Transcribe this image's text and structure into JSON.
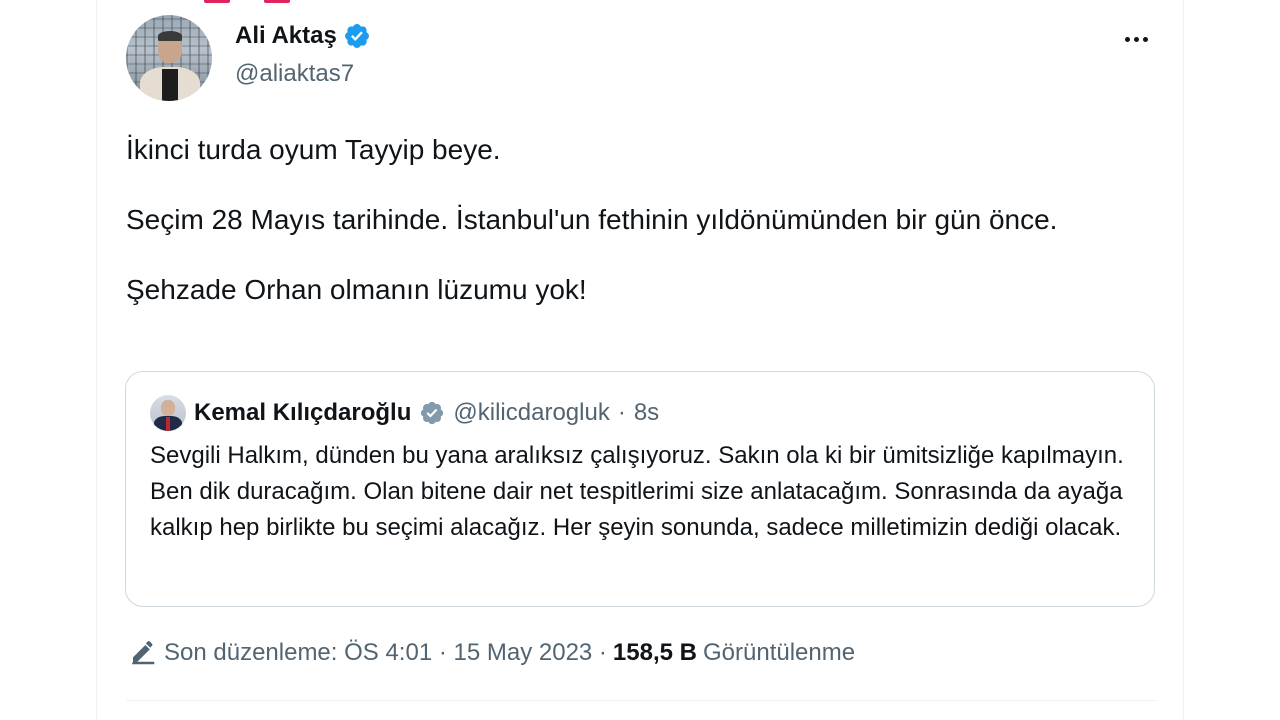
{
  "author": {
    "display_name": "Ali Aktaş",
    "handle": "@aliaktas7"
  },
  "tweet": {
    "paragraphs": [
      "İkinci turda oyum Tayyip beye.",
      "Seçim 28 Mayıs tarihinde. İstanbul'un fethinin yıldönümünden bir gün önce.",
      "Şehzade Orhan olmanın lüzumu yok!"
    ]
  },
  "quoted_tweet": {
    "display_name": "Kemal Kılıçdaroğlu",
    "handle": "@kilicdarogluk",
    "separator": "·",
    "time": "8s",
    "text": "Sevgili Halkım, dünden bu yana aralıksız çalışıyoruz. Sakın ola ki bir ümitsizliğe kapılmayın. Ben dik duracağım. Olan bitene dair net tespitlerimi size anlatacağım. Sonrasında da ayağa kalkıp hep birlikte bu seçimi alacağız. Her şeyin sonunda, sadece milletimizin dediği olacak."
  },
  "meta": {
    "edited_label": "Son düzenleme: ÖS 4:01 · 15 May 2023 ·",
    "views_count": "158,5 B",
    "views_label": "Görüntülenme"
  },
  "icons": {
    "verified": "verified-badge-icon",
    "verified_quote": "verified-gray-badge-icon",
    "more": "more-dots-icon",
    "edit": "pencil-edit-icon"
  },
  "colors": {
    "verified_blue": "#1d9bf0",
    "verified_gray": "#829aab",
    "secondary_text": "#536471",
    "border": "#cfd9de"
  }
}
